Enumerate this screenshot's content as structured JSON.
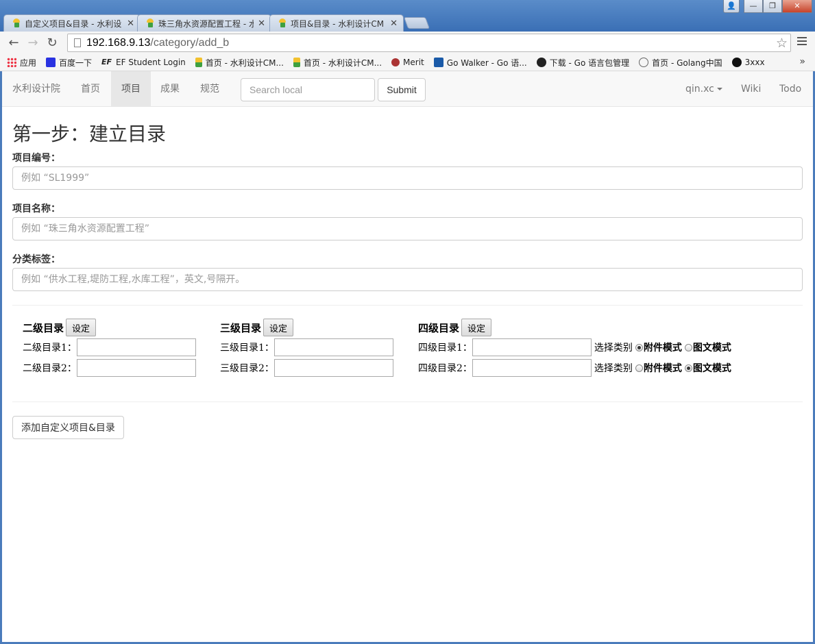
{
  "browser": {
    "tabs": [
      {
        "title": "自定义项目&目录 - 水利设",
        "active": true
      },
      {
        "title": "珠三角水资源配置工程 - 水",
        "active": false
      },
      {
        "title": "项目&目录 - 水利设计CM",
        "active": false
      }
    ],
    "url_host": "192.168.9.13",
    "url_path": "/category/add_b",
    "bookmarks": [
      {
        "label": "应用",
        "icon": "apps-grid-icon",
        "color": "#e34"
      },
      {
        "label": "百度一下",
        "icon": "baidu-paw-icon",
        "color": "#2932e1"
      },
      {
        "label": "EF Student Login",
        "icon": "ef-logo-icon",
        "color": "#333"
      },
      {
        "label": "首页 - 水利设计CM...",
        "icon": "site-favicon-icon",
        "color": "#3fa040"
      },
      {
        "label": "首页 - 水利设计CM...",
        "icon": "site-favicon-icon",
        "color": "#3fa040"
      },
      {
        "label": "Merit",
        "icon": "merit-icon",
        "color": "#a33"
      },
      {
        "label": "Go Walker - Go 语...",
        "icon": "godoc-icon",
        "color": "#1a5aa8"
      },
      {
        "label": "下载 - Go 语言包管理",
        "icon": "gopher-icon",
        "color": "#222"
      },
      {
        "label": "首页 - Golang中国",
        "icon": "golang-china-icon",
        "color": "#666"
      },
      {
        "label": "3xxx",
        "icon": "github-icon",
        "color": "#111"
      }
    ],
    "more_label": "»"
  },
  "navbar": {
    "brand": "水利设计院",
    "items": [
      "首页",
      "项目",
      "成果",
      "规范"
    ],
    "active_item": "项目",
    "search_placeholder": "Search local",
    "submit_label": "Submit",
    "user": "qin.xc",
    "right_links": [
      "Wiki",
      "Todo"
    ]
  },
  "form": {
    "heading": "第一步：建立目录",
    "fields": [
      {
        "label": "项目编号：",
        "placeholder": "例如 “SL1999”"
      },
      {
        "label": "项目名称：",
        "placeholder": "例如 “珠三角水资源配置工程”"
      },
      {
        "label": "分类标签：",
        "placeholder": "例如 “供水工程,堤防工程,水库工程”，英文,号隔开。"
      }
    ],
    "levels": [
      {
        "title": "二级目录",
        "set_label": "设定",
        "rows": [
          "二级目录1：",
          "二级目录2："
        ]
      },
      {
        "title": "三级目录",
        "set_label": "设定",
        "rows": [
          "三级目录1：",
          "三级目录2："
        ]
      },
      {
        "title": "四级目录",
        "set_label": "设定",
        "rows": [
          "四级目录1：",
          "四级目录2："
        ]
      }
    ],
    "category_label": "选择类别",
    "options": [
      "附件模式",
      "图文模式"
    ],
    "row_selected": [
      "附件模式",
      "图文模式"
    ],
    "add_button": "添加自定义项目&目录"
  }
}
